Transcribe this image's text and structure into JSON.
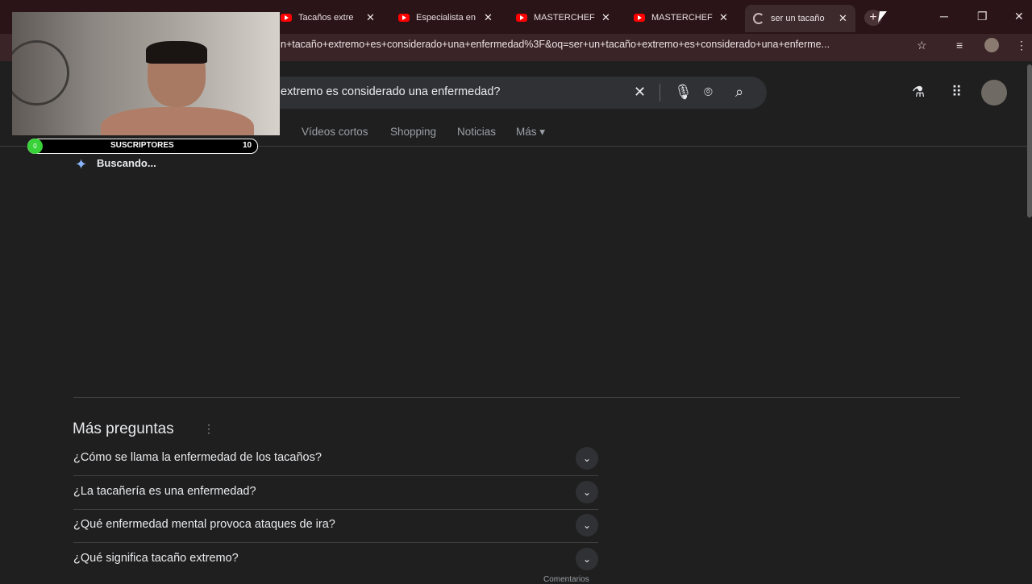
{
  "browser": {
    "tabs": [
      {
        "title": "Tacaños extre",
        "icon": "youtube-icon"
      },
      {
        "title": "Especialista en",
        "icon": "youtube-icon"
      },
      {
        "title": "MASTERCHEF",
        "icon": "youtube-icon"
      },
      {
        "title": "MASTERCHEF",
        "icon": "youtube-icon"
      },
      {
        "title": "ser un tacaño",
        "icon": "loading-spinner-icon",
        "active": true
      }
    ],
    "new_tab": "+",
    "window_controls": {
      "minimize": "─",
      "restore": "❐",
      "close": "✕"
    },
    "url": "n+tacaño+extremo+es+considerado+una+enfermedad%3F&oq=ser+un+tacaño+extremo+es+considerado+una+enferme..."
  },
  "search": {
    "query": "extremo es considerado una enfermedad?",
    "nav_tabs": [
      "Vídeos cortos",
      "Shopping",
      "Noticias",
      "Más ▾"
    ]
  },
  "ai_overview": {
    "status": "Buscando..."
  },
  "more_questions": {
    "title": "Más preguntas",
    "items": [
      "¿Cómo se llama la enfermedad de los tacaños?",
      "¿La tacañería es una enfermedad?",
      "¿Qué enfermedad mental provoca ataques de ira?",
      "¿Qué significa tacaño extremo?"
    ],
    "footer": "Comentarios"
  },
  "overlay": {
    "subscribers_label": "SUSCRIPTORES",
    "subscribers_count": "10",
    "dot": "0"
  },
  "colors": {
    "accent": "#8ab4f8",
    "youtube": "#ff0000",
    "subscriber_dot": "#39d339"
  }
}
